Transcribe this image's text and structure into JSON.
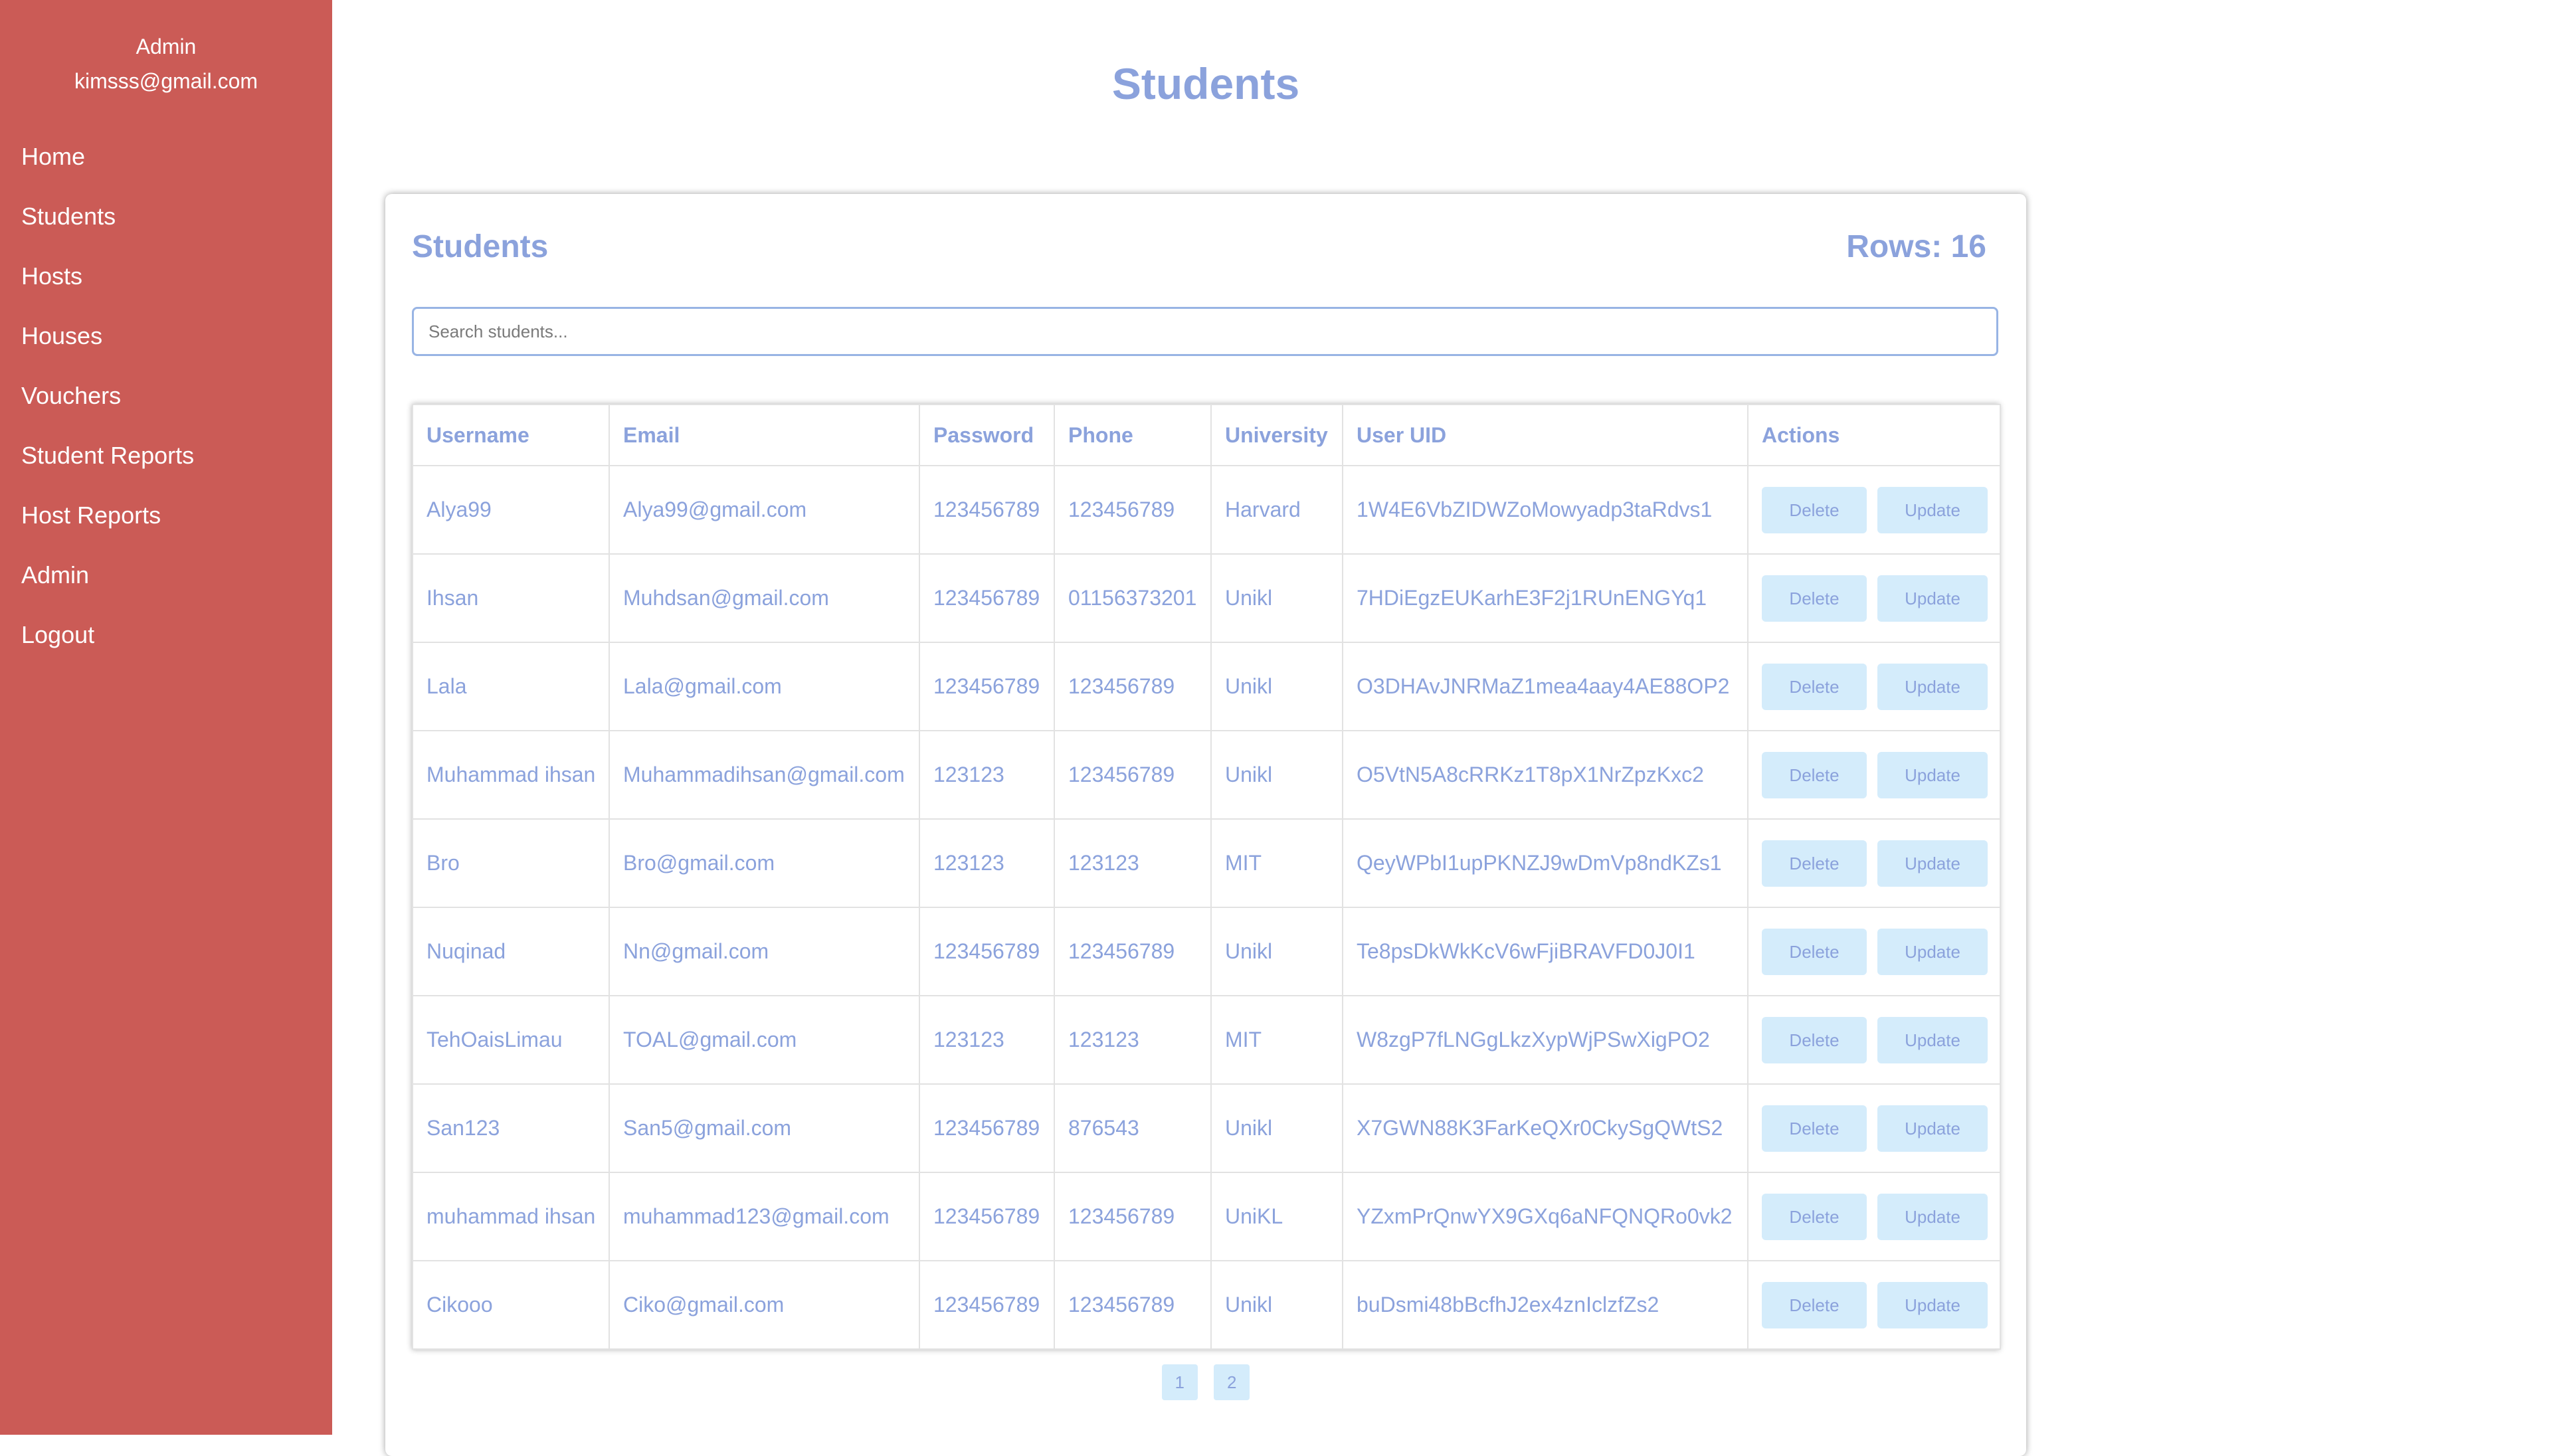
{
  "sidebar": {
    "role": "Admin",
    "email": "kimsss@gmail.com",
    "items": [
      "Home",
      "Students",
      "Hosts",
      "Houses",
      "Vouchers",
      "Student Reports",
      "Host Reports",
      "Admin",
      "Logout"
    ]
  },
  "page_title": "Students",
  "card": {
    "title": "Students",
    "rows_label": "Rows: 16",
    "search_placeholder": "Search students..."
  },
  "table": {
    "headers": [
      "Username",
      "Email",
      "Password",
      "Phone",
      "University",
      "User UID",
      "Actions"
    ],
    "rows": [
      [
        "Alya99",
        "Alya99@gmail.com",
        "123456789",
        "123456789",
        "Harvard",
        "1W4E6VbZIDWZoMowyadp3taRdvs1"
      ],
      [
        "Ihsan",
        "Muhdsan@gmail.com",
        "123456789",
        "01156373201",
        "Unikl",
        "7HDiEgzEUKarhE3F2j1RUnENGYq1"
      ],
      [
        "Lala",
        "Lala@gmail.com",
        "123456789",
        "123456789",
        "Unikl",
        "O3DHAvJNRMaZ1mea4aay4AE88OP2"
      ],
      [
        "Muhammad ihsan",
        "Muhammadihsan@gmail.com",
        "123123",
        "123456789",
        "Unikl",
        "O5VtN5A8cRRKz1T8pX1NrZpzKxc2"
      ],
      [
        "Bro",
        "Bro@gmail.com",
        "123123",
        "123123",
        "MIT",
        "QeyWPbI1upPKNZJ9wDmVp8ndKZs1"
      ],
      [
        "Nuqinad",
        "Nn@gmail.com",
        "123456789",
        "123456789",
        "Unikl",
        "Te8psDkWkKcV6wFjiBRAVFD0J0I1"
      ],
      [
        "TehOaisLimau",
        "TOAL@gmail.com",
        "123123",
        "123123",
        "MIT",
        "W8zgP7fLNGgLkzXypWjPSwXigPO2"
      ],
      [
        "San123",
        "San5@gmail.com",
        "123456789",
        "876543",
        "Unikl",
        "X7GWN88K3FarKeQXr0CkySgQWtS2"
      ],
      [
        "muhammad ihsan",
        "muhammad123@gmail.com",
        "123456789",
        "123456789",
        "UniKL",
        "YZxmPrQnwYX9GXq6aNFQNQRo0vk2"
      ],
      [
        "Cikooo",
        "Ciko@gmail.com",
        "123456789",
        "123456789",
        "Unikl",
        "buDsmi48bBcfhJ2ex4znIclzfZs2"
      ]
    ],
    "delete_label": "Delete",
    "update_label": "Update"
  },
  "pagination": [
    "1",
    "2"
  ],
  "colors": {
    "sidebar_bg": "#cb5b56",
    "accent_text": "#8ba2dc",
    "button_bg": "#d4ecfb"
  }
}
